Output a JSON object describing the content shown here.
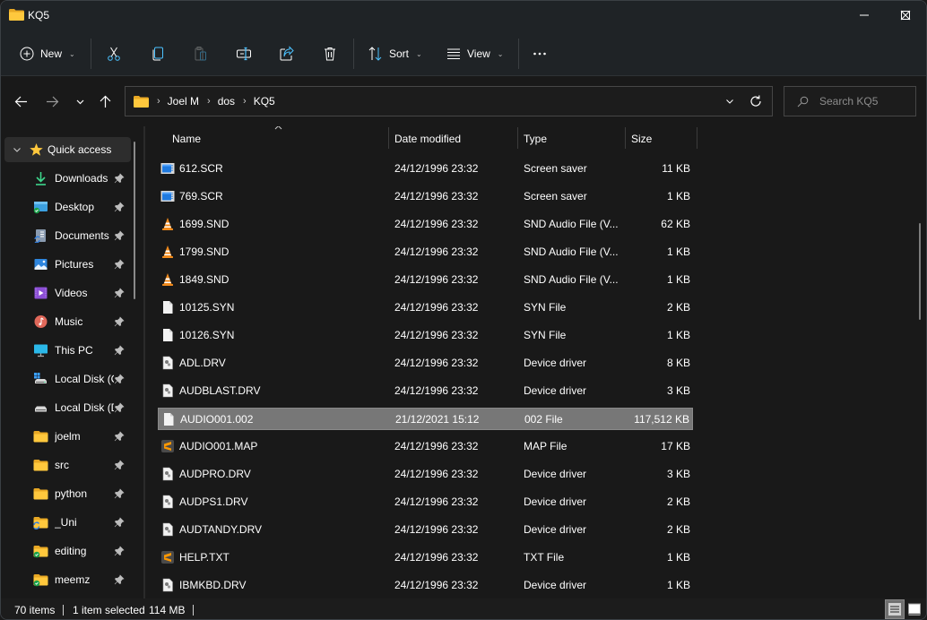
{
  "window": {
    "title": "KQ5",
    "controls": {
      "minimize": "minimize-icon",
      "maximize": "maximize-icon",
      "close": "close-icon"
    }
  },
  "toolbar": {
    "new_label": "New",
    "sort_label": "Sort",
    "view_label": "View",
    "icons": [
      "plus-circle-icon",
      "cut-icon",
      "copy-icon",
      "paste-icon",
      "rename-icon",
      "share-icon",
      "delete-icon",
      "sort-icon",
      "view-icon",
      "more-icon"
    ]
  },
  "navigation": {
    "breadcrumb": [
      "Joel M",
      "dos",
      "KQ5"
    ],
    "search_placeholder": "Search KQ5"
  },
  "sidebar": {
    "header": {
      "label": "Quick access",
      "icon": "star-icon",
      "expanded": true
    },
    "items": [
      {
        "label": "Downloads",
        "icon": "downloads-icon",
        "pinned": true
      },
      {
        "label": "Desktop",
        "icon": "desktop-icon",
        "pinned": true
      },
      {
        "label": "Documents",
        "icon": "documents-icon",
        "pinned": true
      },
      {
        "label": "Pictures",
        "icon": "pictures-icon",
        "pinned": true
      },
      {
        "label": "Videos",
        "icon": "videos-icon",
        "pinned": true
      },
      {
        "label": "Music",
        "icon": "music-icon",
        "pinned": true
      },
      {
        "label": "This PC",
        "icon": "this-pc-icon",
        "pinned": true
      },
      {
        "label": "Local Disk (C:)",
        "icon": "local-disk-c-icon",
        "pinned": true
      },
      {
        "label": "Local Disk (D:)",
        "icon": "local-disk-icon",
        "pinned": true
      },
      {
        "label": "joelm",
        "icon": "folder-icon",
        "pinned": true
      },
      {
        "label": "src",
        "icon": "folder-icon",
        "pinned": true
      },
      {
        "label": "python",
        "icon": "folder-icon",
        "pinned": true
      },
      {
        "label": "_Uni",
        "icon": "folder-sync-icon",
        "pinned": true
      },
      {
        "label": "editing",
        "icon": "folder-synced-icon",
        "pinned": true
      },
      {
        "label": "meemz",
        "icon": "folder-synced-icon",
        "pinned": true
      }
    ]
  },
  "filelist": {
    "columns": [
      "Name",
      "Date modified",
      "Type",
      "Size"
    ],
    "sorted_by": "Name",
    "files": [
      {
        "name": "612.SCR",
        "date": "24/12/1996 23:32",
        "type": "Screen saver",
        "size": "11 KB",
        "icon": "screensaver-icon"
      },
      {
        "name": "769.SCR",
        "date": "24/12/1996 23:32",
        "type": "Screen saver",
        "size": "1 KB",
        "icon": "screensaver-icon"
      },
      {
        "name": "1699.SND",
        "date": "24/12/1996 23:32",
        "type": "SND Audio File (V...",
        "size": "62 KB",
        "icon": "vlc-icon"
      },
      {
        "name": "1799.SND",
        "date": "24/12/1996 23:32",
        "type": "SND Audio File (V...",
        "size": "1 KB",
        "icon": "vlc-icon"
      },
      {
        "name": "1849.SND",
        "date": "24/12/1996 23:32",
        "type": "SND Audio File (V...",
        "size": "1 KB",
        "icon": "vlc-icon"
      },
      {
        "name": "10125.SYN",
        "date": "24/12/1996 23:32",
        "type": "SYN File",
        "size": "2 KB",
        "icon": "blank-file-icon"
      },
      {
        "name": "10126.SYN",
        "date": "24/12/1996 23:32",
        "type": "SYN File",
        "size": "1 KB",
        "icon": "blank-file-icon"
      },
      {
        "name": "ADL.DRV",
        "date": "24/12/1996 23:32",
        "type": "Device driver",
        "size": "8 KB",
        "icon": "driver-file-icon"
      },
      {
        "name": "AUDBLAST.DRV",
        "date": "24/12/1996 23:32",
        "type": "Device driver",
        "size": "3 KB",
        "icon": "driver-file-icon"
      },
      {
        "name": "AUDIO001.002",
        "date": "21/12/2021 15:12",
        "type": "002 File",
        "size": "117,512 KB",
        "icon": "blank-file-icon",
        "selected": true
      },
      {
        "name": "AUDIO001.MAP",
        "date": "24/12/1996 23:32",
        "type": "MAP File",
        "size": "17 KB",
        "icon": "sublime-text-icon"
      },
      {
        "name": "AUDPRO.DRV",
        "date": "24/12/1996 23:32",
        "type": "Device driver",
        "size": "3 KB",
        "icon": "driver-file-icon"
      },
      {
        "name": "AUDPS1.DRV",
        "date": "24/12/1996 23:32",
        "type": "Device driver",
        "size": "2 KB",
        "icon": "driver-file-icon"
      },
      {
        "name": "AUDTANDY.DRV",
        "date": "24/12/1996 23:32",
        "type": "Device driver",
        "size": "2 KB",
        "icon": "driver-file-icon"
      },
      {
        "name": "HELP.TXT",
        "date": "24/12/1996 23:32",
        "type": "TXT File",
        "size": "1 KB",
        "icon": "sublime-text-icon"
      },
      {
        "name": "IBMKBD.DRV",
        "date": "24/12/1996 23:32",
        "type": "Device driver",
        "size": "1 KB",
        "icon": "driver-file-icon"
      }
    ]
  },
  "statusbar": {
    "item_count": "70 items",
    "selection": "1 item selected",
    "selection_size": "114 MB",
    "active_view": "details"
  },
  "colors": {
    "accent": "#4cc2ff",
    "folder": "#ffc83d",
    "selection": "#777777"
  }
}
